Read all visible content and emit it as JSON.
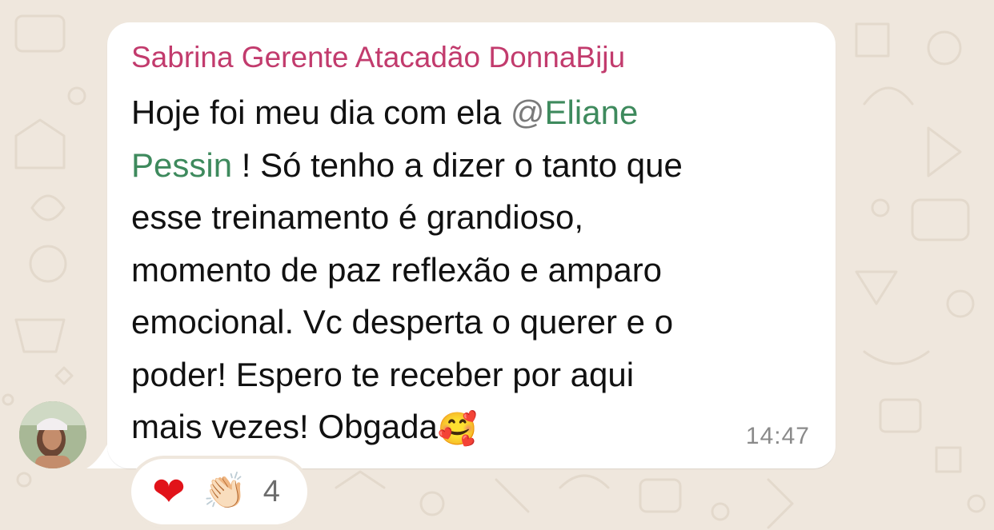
{
  "chat": {
    "sender_name": "Sabrina Gerente Atacadão DonnaBiju",
    "message": {
      "line1_text": "Hoje foi meu dia com ela ",
      "mention_at": "@",
      "mention_name_part1": "Eliane",
      "mention_name_part2": "Pessin",
      "line2_text": " ! Só tenho a dizer o tanto que",
      "line3_text": "esse treinamento é grandioso,",
      "line4_text": "momento de paz reflexão e amparo",
      "line5_text": "emocional. Vc desperta o querer e o",
      "line6_text": "poder! Espero te receber  por aqui",
      "line7_text": "mais vezes! Obgada",
      "line7_emoji": "🥰"
    },
    "timestamp": "14:47",
    "reactions": {
      "emojis": [
        "❤",
        "👏🏻"
      ],
      "count": "4"
    }
  },
  "colors": {
    "sender": "#c23b6d",
    "mention": "#3e8a5d",
    "background": "#efe7dd",
    "bubble": "#ffffff"
  }
}
